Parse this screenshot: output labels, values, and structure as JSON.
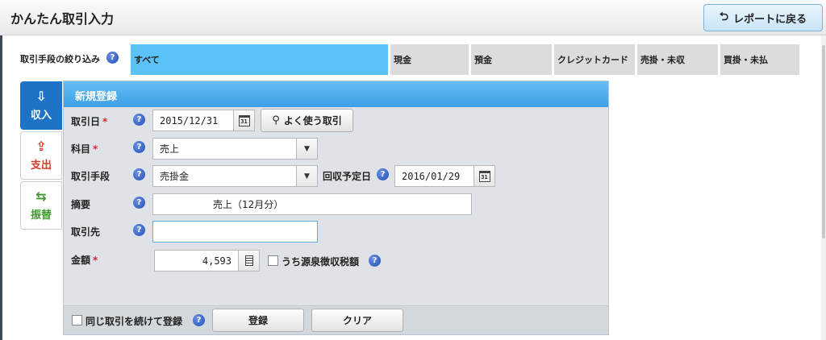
{
  "app": {
    "title": "かんたん取引入力"
  },
  "header": {
    "report_button_label": "レポートに戻る",
    "report_icon": "return-arrow-icon"
  },
  "filter": {
    "label": "取引手段の絞り込み",
    "tabs": [
      {
        "label": "すべて",
        "active": true
      },
      {
        "label": "現金",
        "active": false
      },
      {
        "label": "預金",
        "active": false
      },
      {
        "label": "クレジットカード",
        "active": false
      },
      {
        "label": "売掛・未収",
        "active": false
      },
      {
        "label": "買掛・未払",
        "active": false
      }
    ]
  },
  "side_tabs": [
    {
      "label": "収入",
      "icon": "inbox-down-icon",
      "active": true
    },
    {
      "label": "支出",
      "icon": "outbox-up-icon",
      "active": false
    },
    {
      "label": "振替",
      "icon": "transfer-arrows-icon",
      "active": false
    }
  ],
  "form": {
    "title": "新規登録",
    "date": {
      "label": "取引日",
      "value": "2015/12/31"
    },
    "frequent_button_label": "よく使う取引",
    "account": {
      "label": "科目",
      "value": "売上"
    },
    "method": {
      "label": "取引手段",
      "value": "売掛金"
    },
    "collection_date": {
      "label": "回収予定日",
      "value": "2016/01/29"
    },
    "memo": {
      "label": "摘要",
      "value": "売上（12月分）"
    },
    "partner": {
      "label": "取引先",
      "value": ""
    },
    "amount": {
      "label": "金額",
      "value": "4,593"
    },
    "withholding_label": "うち源泉徴収税額",
    "required_mark": "*",
    "help_mark": "?",
    "calendar_day": "31"
  },
  "footer": {
    "continue_label": "同じ取引を続けて登録",
    "register_button": "登録",
    "clear_button": "クリア"
  },
  "colors": {
    "accent": "#5bc2f7",
    "income": "#1d74c6",
    "expense": "#d93a2a",
    "transfer": "#3a9a2a",
    "required": "#d9272e"
  }
}
